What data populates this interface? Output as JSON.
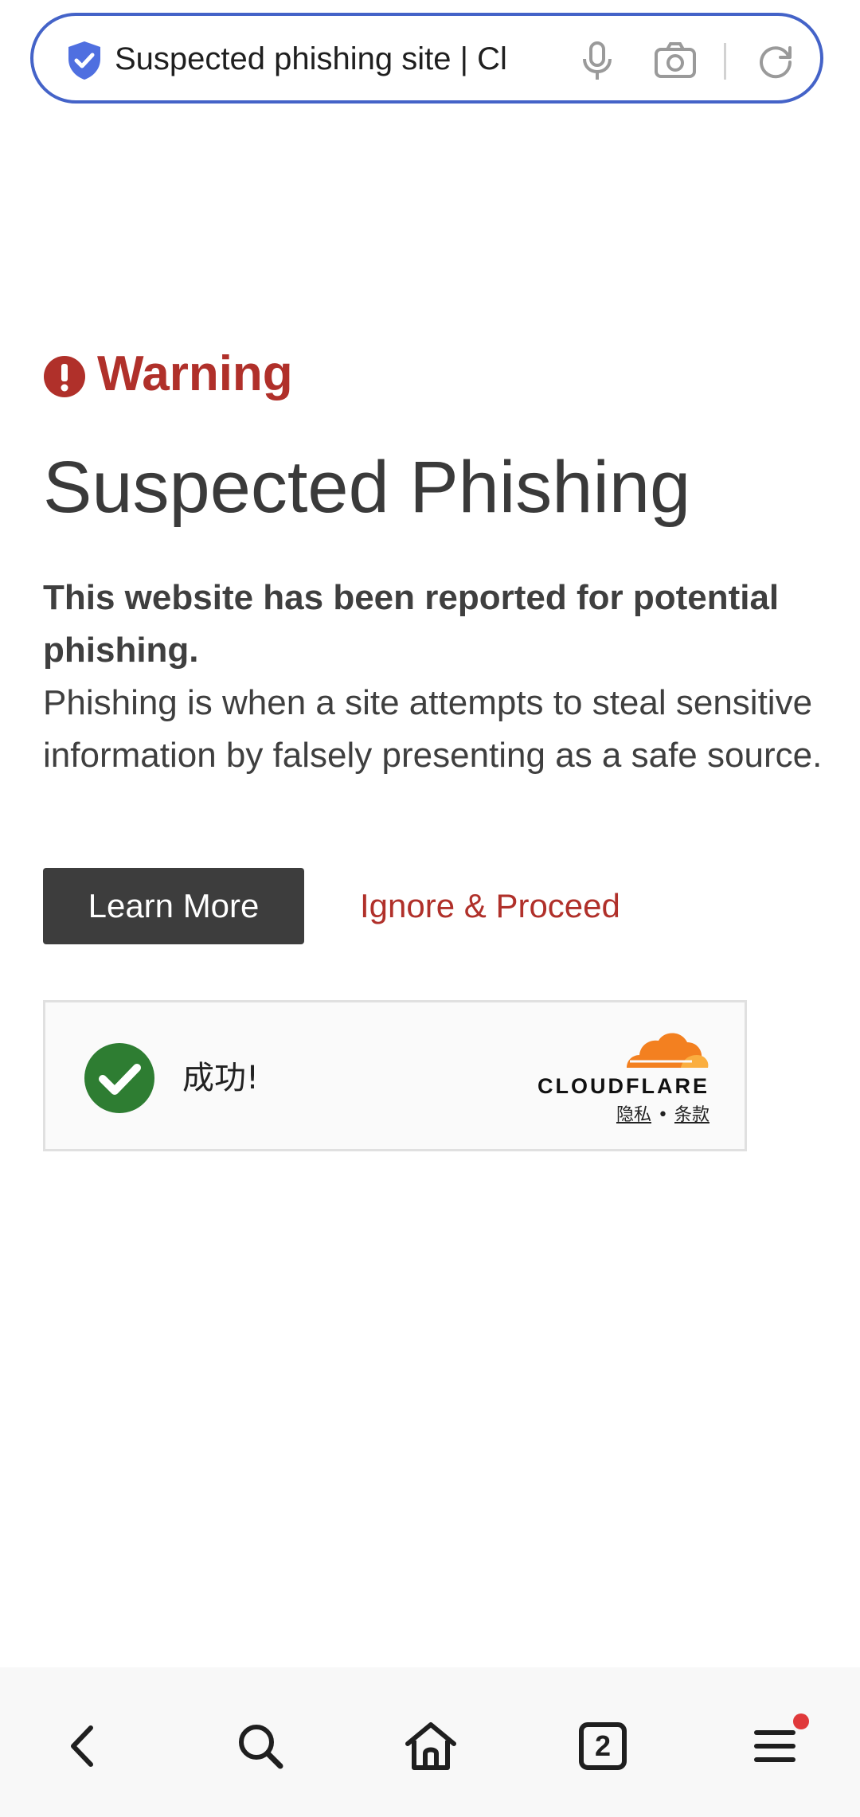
{
  "address_bar": {
    "url_text": "Suspected phishing site | Cl",
    "icons": [
      "shield-check-icon",
      "microphone-icon",
      "camera-icon",
      "reload-icon"
    ],
    "accent_color": "#4463c8"
  },
  "warning": {
    "label": "Warning",
    "title": "Suspected Phishing",
    "message_bold": "This website has been reported for potential phishing.",
    "message": "Phishing is when a site attempts to steal sensitive information by falsely presenting as a safe source.",
    "color": "#b0302a"
  },
  "actions": {
    "learn_more": "Learn More",
    "ignore_proceed": "Ignore & Proceed"
  },
  "cloudflare_widget": {
    "status": "成功!",
    "brand": "CLOUDFLARE",
    "privacy_link": "隐私",
    "separator": "•",
    "terms_link": "条款",
    "success_color": "#2e7d32",
    "brand_color": "#f38020"
  },
  "bottom_nav": {
    "tab_count": "2",
    "items": [
      "back-icon",
      "search-icon",
      "home-icon",
      "tabs-icon",
      "menu-icon"
    ],
    "notification_dot_color": "#e0393b"
  }
}
